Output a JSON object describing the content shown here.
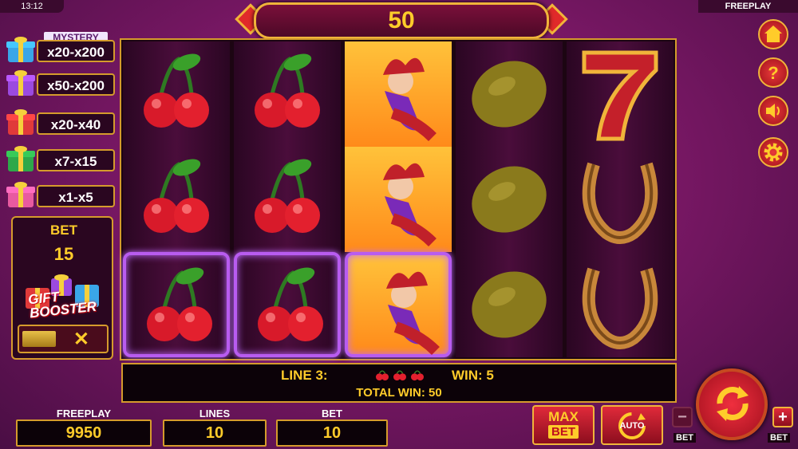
{
  "status": {
    "time": "13:12",
    "mode": "FREEPLAY"
  },
  "win_display": "50",
  "mystery": {
    "title": "MYSTERY",
    "rows": [
      {
        "range": "x20-x200",
        "gift_color": "#3aa6e8"
      },
      {
        "range": "x50-x200",
        "gift_color": "#9b4ae0"
      },
      {
        "range": "x20-x40",
        "gift_color": "#e03a3a"
      },
      {
        "range": "x7-x15",
        "gift_color": "#2ea84a"
      },
      {
        "range": "x1-x5",
        "gift_color": "#e85aa0"
      }
    ]
  },
  "bet_panel": {
    "title": "BET",
    "value": "15",
    "booster_line1": "GIFT",
    "booster_line2": "BOOSTER",
    "toggle_close": "✕"
  },
  "reels": [
    [
      "cherry",
      "cherry",
      "cherry"
    ],
    [
      "cherry",
      "cherry",
      "cherry"
    ],
    [
      "joker",
      "joker",
      "joker"
    ],
    [
      "lemon",
      "lemon",
      "lemon"
    ],
    [
      "seven",
      "horseshoe",
      "horseshoe"
    ]
  ],
  "info": {
    "line": "LINE 3:",
    "win": "WIN: 5",
    "total": "TOTAL WIN: 50"
  },
  "fields": {
    "freeplay_label": "FREEPLAY",
    "freeplay_value": "9950",
    "lines_label": "LINES",
    "lines_value": "10",
    "bet_label": "BET",
    "bet_value": "10"
  },
  "buttons": {
    "max_bet_1": "MAX",
    "max_bet_2": "BET",
    "auto": "AUTO",
    "bet_minus": "−",
    "bet_minus_label": "BET",
    "bet_plus": "+",
    "bet_plus_label": "BET"
  },
  "side_icons": [
    "home-icon",
    "help-icon",
    "sound-icon",
    "settings-icon"
  ],
  "colors": {
    "gold": "#ffcc2a",
    "frame": "#d59b2c",
    "highlight": "#b85cf0"
  }
}
